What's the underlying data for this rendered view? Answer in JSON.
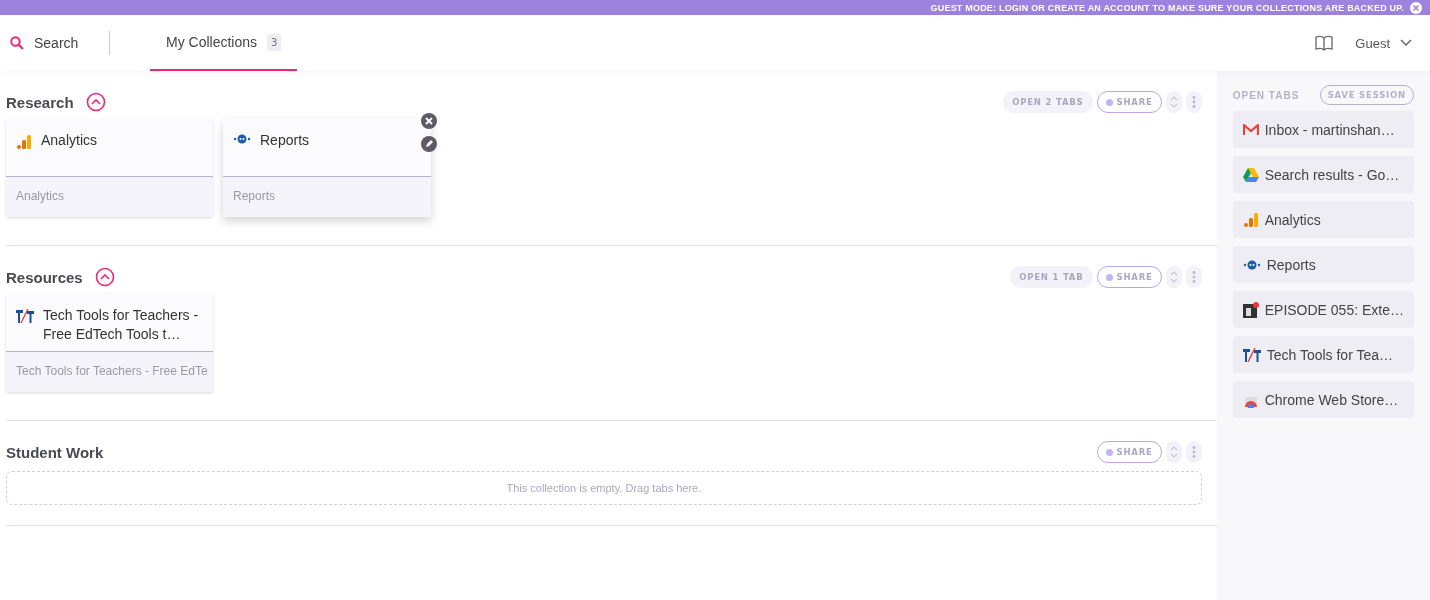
{
  "banner": {
    "text": "GUEST MODE: LOGIN OR CREATE AN ACCOUNT TO MAKE SURE YOUR COLLECTIONS ARE BACKED UP."
  },
  "header": {
    "search": {
      "placeholder": "Search"
    },
    "tabs": [
      {
        "label": "My Collections",
        "count": "3",
        "selected": true
      }
    ],
    "user": "Guest"
  },
  "collections": [
    {
      "title": "Research",
      "expanded": true,
      "open_label": "OPEN 2 TABS",
      "share": "SHARE",
      "cards": [
        {
          "kind": "analytics",
          "title": "Analytics",
          "subtitle": "Analytics",
          "hovered": false
        },
        {
          "kind": "reports",
          "title": "Reports",
          "subtitle": "Reports",
          "hovered": true
        }
      ]
    },
    {
      "title": "Resources",
      "expanded": true,
      "open_label": "OPEN 1 TAB",
      "share": "SHARE",
      "cards": [
        {
          "kind": "ttt",
          "title": "Tech Tools for Teachers - Free EdTech Tools t…",
          "subtitle": "Tech Tools for Teachers - Free EdTe",
          "hovered": false
        }
      ]
    },
    {
      "title": "Student Work",
      "expanded": false,
      "share": "SHARE",
      "empty_text": "This collection is empty. Drag tabs here."
    }
  ],
  "open_tabs": {
    "title": "OPEN TABS",
    "save": "SAVE SESSION",
    "items": [
      {
        "kind": "gmail",
        "label": "Inbox - martinshan…"
      },
      {
        "kind": "drive",
        "label": "Search results - Go…"
      },
      {
        "kind": "analytics",
        "label": "Analytics"
      },
      {
        "kind": "reports",
        "label": "Reports"
      },
      {
        "kind": "episode",
        "label": "EPISODE 055: Exte…"
      },
      {
        "kind": "ttt",
        "label": "Tech Tools for Tea…"
      },
      {
        "kind": "store",
        "label": "Chrome Web Store…"
      }
    ]
  }
}
